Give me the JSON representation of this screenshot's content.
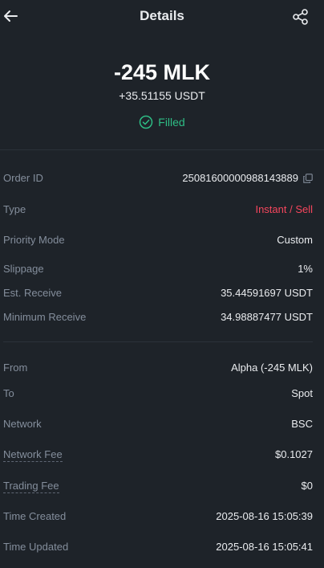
{
  "header": {
    "title": "Details"
  },
  "summary": {
    "amount": "-245 MLK",
    "received": "+35.51155 USDT",
    "status": "Filled"
  },
  "order_rows": [
    {
      "label": "Order ID",
      "value": "25081600000988143889"
    },
    {
      "label": "Type",
      "value": "Instant / Sell"
    },
    {
      "label": "Priority Mode",
      "value": "Custom"
    },
    {
      "label": "Slippage",
      "value": "1%"
    },
    {
      "label": "Est. Receive",
      "value": "35.44591697 USDT"
    },
    {
      "label": "Minimum Receive",
      "value": "34.98887477 USDT"
    }
  ],
  "transfer_rows": [
    {
      "label": "From",
      "value": "Alpha (-245 MLK)"
    },
    {
      "label": "To",
      "value": "Spot"
    },
    {
      "label": "Network",
      "value": "BSC"
    },
    {
      "label": "Network Fee",
      "value": "$0.1027"
    },
    {
      "label": "Trading Fee",
      "value": "$0"
    },
    {
      "label": "Time Created",
      "value": "2025-08-16 15:05:39"
    },
    {
      "label": "Time Updated",
      "value": "2025-08-16 15:05:41"
    }
  ],
  "colors": {
    "background": "#1e2329",
    "success": "#2ebd85",
    "sell": "#f6465d",
    "muted_text": "#848e9c"
  }
}
